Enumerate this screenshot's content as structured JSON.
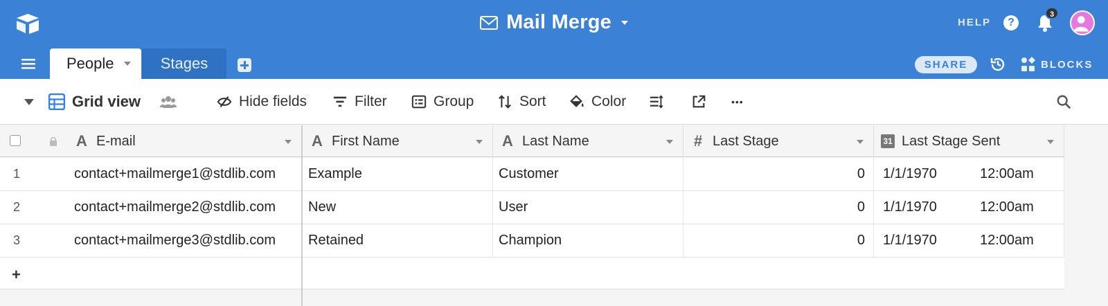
{
  "header": {
    "base_name": "Mail Merge",
    "help_label": "HELP",
    "help_glyph": "?",
    "notification_count": "3",
    "share_label": "SHARE",
    "blocks_label": "BLOCKS",
    "accent_color": "#3b82d6"
  },
  "tabs": [
    {
      "label": "People",
      "active": true
    },
    {
      "label": "Stages",
      "active": false
    }
  ],
  "toolbar": {
    "view_name": "Grid view",
    "hide_fields": "Hide fields",
    "filter": "Filter",
    "group": "Group",
    "sort": "Sort",
    "color": "Color",
    "more_glyph": "•••"
  },
  "grid": {
    "columns": [
      {
        "label": "E-mail",
        "icon": "text-field-icon"
      },
      {
        "label": "First Name",
        "icon": "text-field-icon"
      },
      {
        "label": "Last Name",
        "icon": "text-field-icon"
      },
      {
        "label": "Last Stage",
        "icon": "number-field-icon"
      },
      {
        "label": "Last Stage Sent",
        "icon": "date-field-icon"
      }
    ],
    "date_icon_text": "31",
    "rows": [
      {
        "num": "1",
        "email": "contact+mailmerge1@stdlib.com",
        "first": "Example",
        "last": "Customer",
        "stage": "0",
        "date": "1/1/1970",
        "time": "12:00am"
      },
      {
        "num": "2",
        "email": "contact+mailmerge2@stdlib.com",
        "first": "New",
        "last": "User",
        "stage": "0",
        "date": "1/1/1970",
        "time": "12:00am"
      },
      {
        "num": "3",
        "email": "contact+mailmerge3@stdlib.com",
        "first": "Retained",
        "last": "Champion",
        "stage": "0",
        "date": "1/1/1970",
        "time": "12:00am"
      }
    ],
    "add_row_glyph": "+"
  }
}
